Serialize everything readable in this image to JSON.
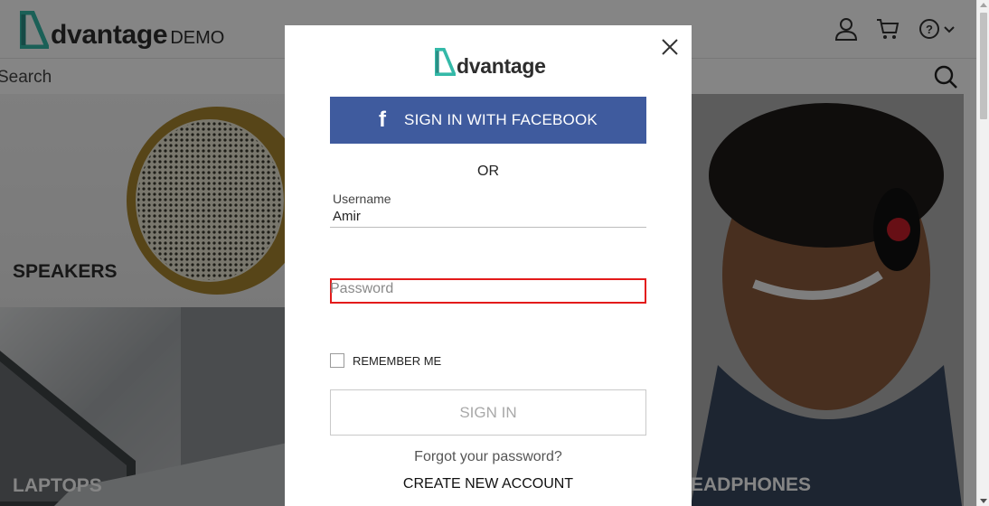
{
  "header": {
    "logo_text": "dvantage",
    "logo_demo": "DEMO",
    "icons": [
      "user-icon",
      "cart-icon",
      "help-icon",
      "chevron-down-icon"
    ]
  },
  "search": {
    "text": "Search"
  },
  "categories": {
    "speakers": "SPEAKERS",
    "laptops": "LAPTOPS",
    "headphones": "EADPHONES"
  },
  "modal": {
    "logo_text": "dvantage",
    "facebook_label": "SIGN IN WITH FACEBOOK",
    "or_text": "OR",
    "username_label": "Username",
    "username_value": "Amir",
    "password_placeholder": "Password",
    "remember_label": "REMEMBER ME",
    "signin_label": "SIGN IN",
    "forgot_label": "Forgot your password?",
    "create_label": "CREATE NEW ACCOUNT"
  },
  "colors": {
    "brand_teal": "#34b9a8",
    "facebook_blue": "#3f5b9e",
    "error_red": "#e31b1b",
    "overlay": "rgba(0,0,0,0.48)"
  }
}
